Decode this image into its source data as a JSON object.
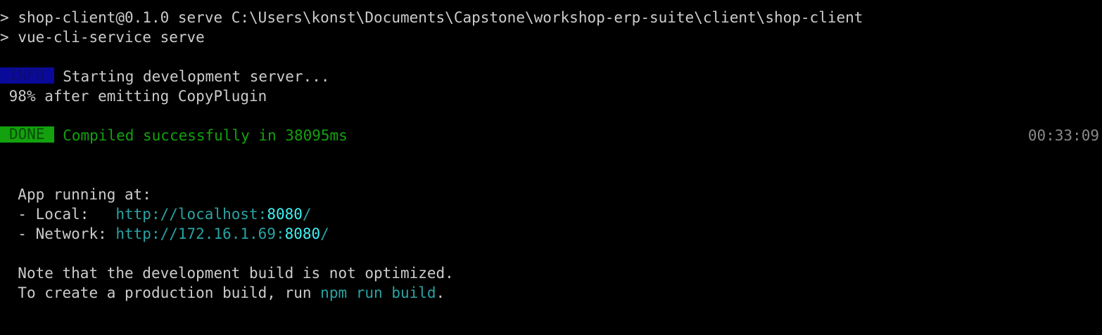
{
  "command": {
    "prompt_symbol": ">",
    "line1": "shop-client@0.1.0 serve C:\\Users\\konst\\Documents\\Capstone\\workshop-erp-suite\\client\\shop-client",
    "line2": "vue-cli-service serve"
  },
  "info": {
    "badge": "INFO",
    "message": "Starting development server...",
    "progress": "98% after emitting CopyPlugin"
  },
  "done": {
    "badge": "DONE",
    "message": "Compiled successfully in 38095ms",
    "time": "00:33:09"
  },
  "app": {
    "heading": "App running at:",
    "local_label": "- Local:   ",
    "local_url": "http://localhost:",
    "local_port": "8080",
    "local_slash": "/",
    "network_label": "- Network: ",
    "network_url": "http://172.16.1.69:",
    "network_port": "8080",
    "network_slash": "/"
  },
  "note": {
    "line1": "Note that the development build is not optimized.",
    "line2_prefix": "To create a production build, run ",
    "line2_cmd": "npm run build",
    "line2_suffix": "."
  },
  "colors": {
    "background": "#000000",
    "text": "#cccccc",
    "info_badge": "#0a0a9a",
    "done_badge": "#13a10e",
    "success_text": "#13a10e",
    "url": "#2aa3a3",
    "port": "#3ef3f3",
    "timestamp": "#8a8a8a"
  }
}
